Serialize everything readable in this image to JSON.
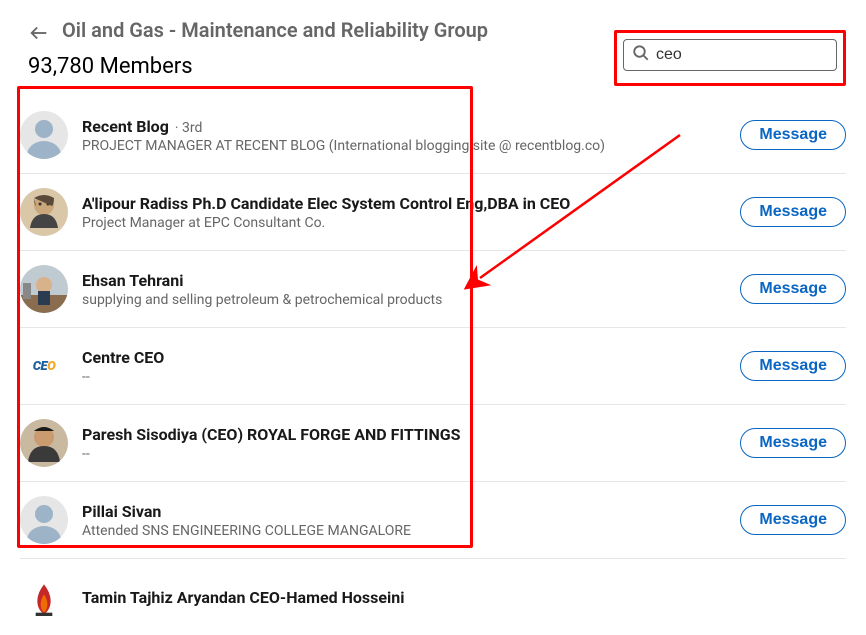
{
  "header": {
    "title": "Oil and Gas - Maintenance and Reliability Group",
    "member_count": "93,780 Members"
  },
  "search": {
    "value": "ceo",
    "placeholder": ""
  },
  "button_label": "Message",
  "members": [
    {
      "name": "Recent Blog",
      "degree": "· 3rd",
      "sub": "PROJECT MANAGER AT RECENT BLOG (International blogging site @ recentblog.co)",
      "avatar": "placeholder"
    },
    {
      "name": "A'lipour Radiss Ph.D Candidate Elec System Control Eng,DBA in CEO",
      "degree": "",
      "sub": "Project Manager at EPC Consultant Co.",
      "avatar": "photo1"
    },
    {
      "name": "Ehsan Tehrani",
      "degree": "",
      "sub": "supplying and selling petroleum & petrochemical products",
      "avatar": "photo2"
    },
    {
      "name": "Centre CEO",
      "degree": "",
      "sub": "--",
      "avatar": "logo"
    },
    {
      "name": "Paresh Sisodiya (CEO) ROYAL FORGE AND FITTINGS",
      "degree": "",
      "sub": "--",
      "avatar": "photo3"
    },
    {
      "name": "Pillai Sivan",
      "degree": "",
      "sub": "Attended SNS ENGINEERING COLLEGE MANGALORE",
      "avatar": "placeholder"
    },
    {
      "name": "Tamin Tajhiz Aryandan CEO-Hamed Hosseini",
      "degree": "",
      "sub": "",
      "avatar": "flame"
    }
  ],
  "annotations": {
    "search_box_highlight": true,
    "list_box_highlight": true,
    "arrow_from_search_to_list": true
  }
}
